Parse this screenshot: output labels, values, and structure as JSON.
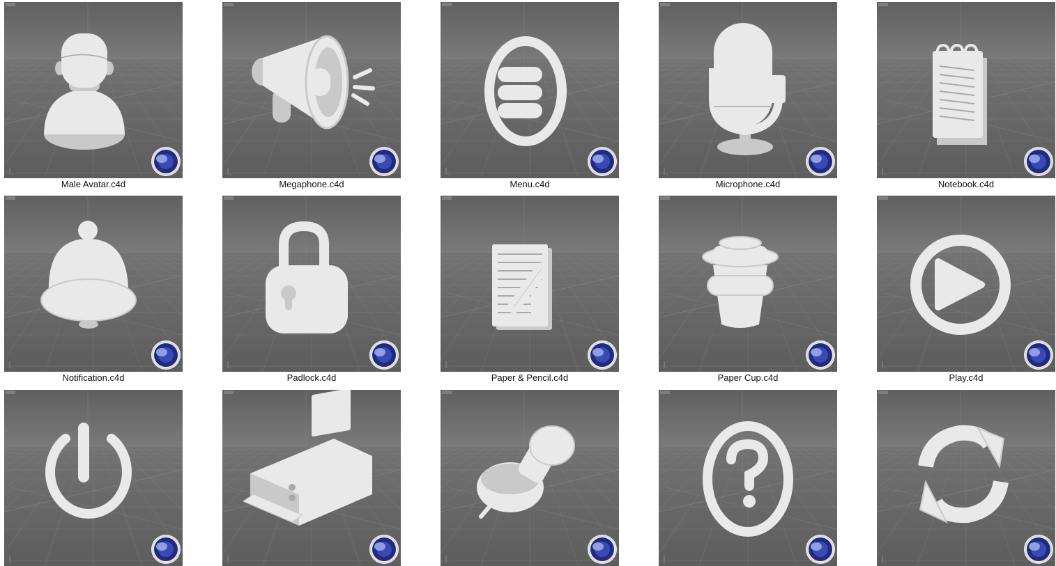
{
  "files": [
    {
      "name": "Male Avatar.c4d",
      "icon": "male-avatar"
    },
    {
      "name": "Megaphone.c4d",
      "icon": "megaphone"
    },
    {
      "name": "Menu.c4d",
      "icon": "menu"
    },
    {
      "name": "Microphone.c4d",
      "icon": "microphone"
    },
    {
      "name": "Notebook.c4d",
      "icon": "notebook"
    },
    {
      "name": "Notification.c4d",
      "icon": "bell"
    },
    {
      "name": "Padlock.c4d",
      "icon": "padlock"
    },
    {
      "name": "Paper & Pencil.c4d",
      "icon": "paper-pencil"
    },
    {
      "name": "Paper Cup.c4d",
      "icon": "paper-cup"
    },
    {
      "name": "Play.c4d",
      "icon": "play"
    },
    {
      "name": "",
      "icon": "power"
    },
    {
      "name": "",
      "icon": "printer"
    },
    {
      "name": "",
      "icon": "push-pin"
    },
    {
      "name": "",
      "icon": "question"
    },
    {
      "name": "",
      "icon": "refresh"
    }
  ],
  "colors": {
    "viewport_background": "#6b6b6b",
    "model": "#e9e9e9",
    "grid": "#7c7c7c",
    "logo": "#1f2a80"
  }
}
